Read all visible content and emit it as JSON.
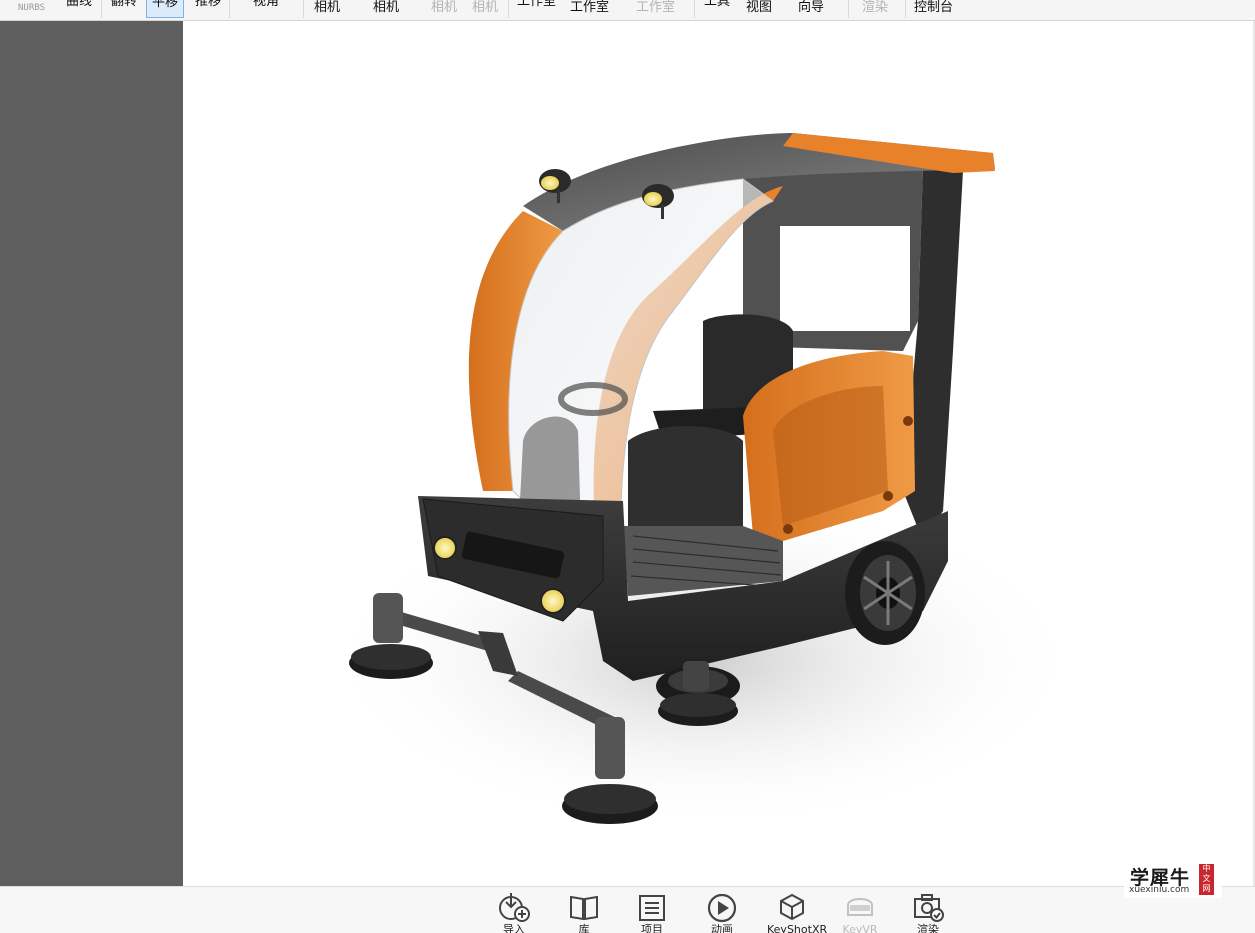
{
  "ribbon": {
    "items": [
      {
        "id": "nurbs",
        "label": "NURBS"
      },
      {
        "id": "curve",
        "label": "曲线"
      },
      {
        "id": "flip",
        "label": "翻转"
      },
      {
        "id": "pan",
        "label": "平移"
      },
      {
        "id": "move",
        "label": "推移"
      },
      {
        "id": "view",
        "label": "视角"
      },
      {
        "id": "camera1",
        "label": "相机"
      },
      {
        "id": "camera2",
        "label": "相机"
      },
      {
        "id": "camera3",
        "label": "相机"
      },
      {
        "id": "camera4",
        "label": "相机"
      },
      {
        "id": "studio1",
        "label": "工作室"
      },
      {
        "id": "studio2",
        "label": "工作室"
      },
      {
        "id": "studio3",
        "label": "工作室"
      },
      {
        "id": "tools",
        "label": "工具"
      },
      {
        "id": "viewmenu",
        "label": "视图"
      },
      {
        "id": "wizard",
        "label": "向导"
      },
      {
        "id": "render",
        "label": "渲染"
      },
      {
        "id": "console",
        "label": "控制台"
      }
    ]
  },
  "bottombar": {
    "buttons": [
      {
        "id": "import",
        "label": "导入",
        "icon": "import-icon"
      },
      {
        "id": "library",
        "label": "库",
        "icon": "library-book-icon"
      },
      {
        "id": "project",
        "label": "项目",
        "icon": "project-list-icon"
      },
      {
        "id": "animation",
        "label": "动画",
        "icon": "play-circle-icon"
      },
      {
        "id": "keyshotxr",
        "label": "KeyShotXR",
        "icon": "cube-rotate-icon"
      },
      {
        "id": "keyvr",
        "label": "KeyVR",
        "icon": "vr-headset-icon"
      },
      {
        "id": "render",
        "label": "渲染",
        "icon": "camera-check-icon"
      }
    ]
  },
  "watermark": {
    "cn": "学犀牛",
    "en": "xuexiniu.com",
    "seal": "中文网"
  },
  "colors": {
    "accent_orange": "#e8822a",
    "body_dark": "#2b2b2b",
    "panel_gray": "#5f5f5f",
    "headlight": "#f6e27a"
  }
}
